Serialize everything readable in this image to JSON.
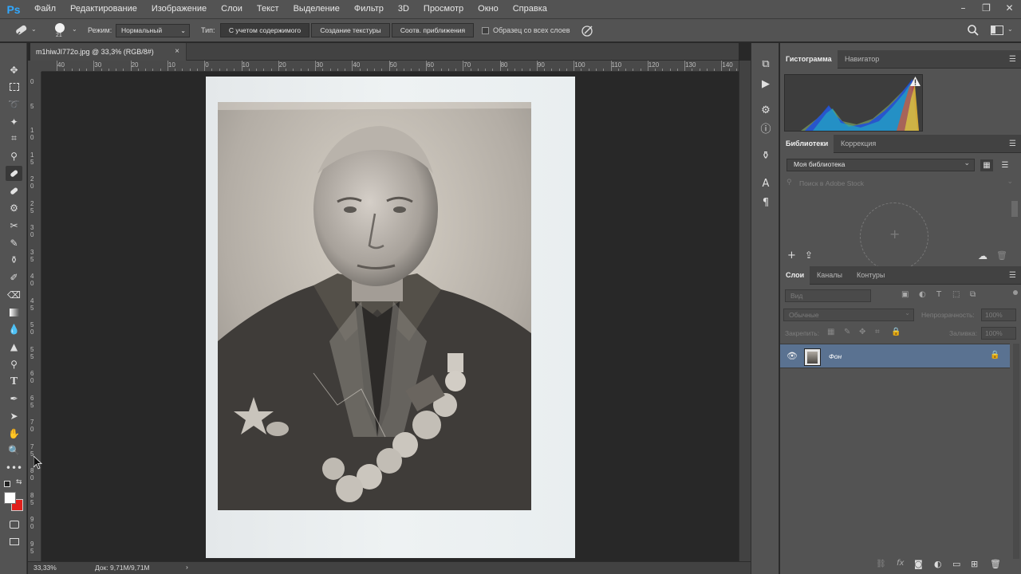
{
  "app": {
    "logo": "Ps",
    "menu": [
      "Файл",
      "Редактирование",
      "Изображение",
      "Слои",
      "Текст",
      "Выделение",
      "Фильтр",
      "3D",
      "Просмотр",
      "Окно",
      "Справка"
    ],
    "window_controls": [
      "–",
      "❐",
      "✕"
    ]
  },
  "options": {
    "brush_size": "21",
    "mode_label": "Режим:",
    "mode_value": "Нормальный",
    "type_label": "Тип:",
    "type_buttons": [
      "С учетом содержимого",
      "Создание текстуры",
      "Соотв. приближения"
    ],
    "sample_all_label": "Образец со всех слоев"
  },
  "document": {
    "tab_title": "m1hiwJI772o.jpg @ 33,3% (RGB/8#)",
    "close": "×"
  },
  "ruler": {
    "top_labels": [
      "40",
      "30",
      "20",
      "10",
      "0",
      "10",
      "20",
      "30",
      "40",
      "50",
      "60",
      "70",
      "80",
      "90",
      "100",
      "110",
      "120",
      "130",
      "140"
    ],
    "left_labels": [
      "0",
      "5",
      "1 0",
      "1 5",
      "2 0",
      "2 5",
      "3 0",
      "3 5",
      "4 0",
      "4 5",
      "5 0",
      "5 5",
      "6 0",
      "6 5",
      "7 0",
      "7 5",
      "8 0",
      "8 5",
      "9 0",
      "9 5"
    ]
  },
  "status": {
    "zoom": "33,33%",
    "doc_size": "Док: 9,71M/9,71M"
  },
  "histogram_panel": {
    "tabs": [
      "Гистограмма",
      "Навигатор"
    ]
  },
  "libraries_panel": {
    "tabs": [
      "Библиотеки",
      "Коррекция"
    ],
    "library_select": "Моя библиотека",
    "search_placeholder": "Поиск в Adobe Stock"
  },
  "layers_panel": {
    "tabs": [
      "Слои",
      "Каналы",
      "Контуры"
    ],
    "kind_filter": "Вид",
    "blend_mode": "Обычные",
    "opacity_label": "Непрозрачность:",
    "opacity_value": "100%",
    "lock_label": "Закрепить:",
    "fill_label": "Заливка:",
    "fill_value": "100%",
    "layers": [
      {
        "name": "Фон",
        "visible": true,
        "locked": true
      }
    ]
  },
  "colors": {
    "foreground": "#ffffff",
    "background": "#e0201c",
    "selected_layer": "#5a7291",
    "accent": "#31a8ff"
  }
}
